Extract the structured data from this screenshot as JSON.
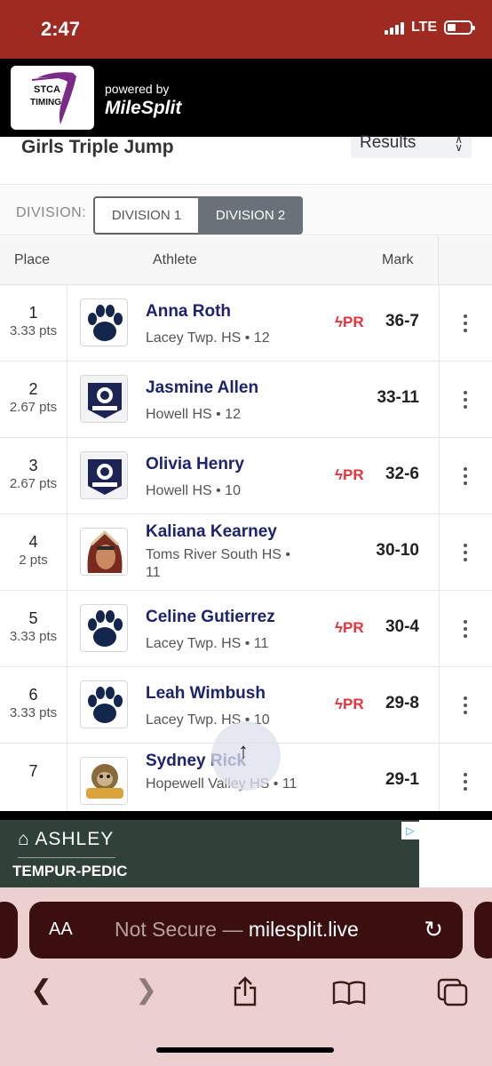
{
  "status": {
    "time": "2:47",
    "network": "LTE"
  },
  "brand": {
    "logo_line1": "STCA",
    "logo_line2": "TIMING",
    "powered_by": "powered by",
    "milesplit": "MileSplit"
  },
  "event": {
    "title": "Girls Triple Jump",
    "view_select": "Results"
  },
  "division": {
    "label": "DIVISION:",
    "options": [
      "DIVISION 1",
      "DIVISION 2"
    ],
    "selected": "DIVISION 2"
  },
  "table": {
    "headers": {
      "place": "Place",
      "athlete": "Athlete",
      "mark": "Mark"
    },
    "rows": [
      {
        "place": "1",
        "points": "3.33 pts",
        "name": "Anna Roth",
        "school": "Lacey Twp. HS • 12",
        "pr": "PR",
        "mark": "36-7",
        "logo": "paw-logo"
      },
      {
        "place": "2",
        "points": "2.67 pts",
        "name": "Jasmine Allen",
        "school": "Howell HS • 12",
        "pr": "",
        "mark": "33-11",
        "logo": "howell-logo"
      },
      {
        "place": "3",
        "points": "2.67 pts",
        "name": "Olivia Henry",
        "school": "Howell HS • 10",
        "pr": "PR",
        "mark": "32-6",
        "logo": "howell-logo"
      },
      {
        "place": "4",
        "points": "2 pts",
        "name": "Kaliana Kearney",
        "school": "Toms River South HS • 11",
        "pr": "",
        "mark": "30-10",
        "logo": "indian-logo"
      },
      {
        "place": "5",
        "points": "3.33 pts",
        "name": "Celine Gutierrez",
        "school": "Lacey Twp. HS • 11",
        "pr": "PR",
        "mark": "30-4",
        "logo": "paw-logo"
      },
      {
        "place": "6",
        "points": "3.33 pts",
        "name": "Leah Wimbush",
        "school": "Lacey Twp. HS • 10",
        "pr": "PR",
        "mark": "29-8",
        "logo": "paw-logo"
      },
      {
        "place": "7",
        "points": "",
        "name": "Sydney Rick",
        "school": "Hopewell Valley HS • 11",
        "pr": "",
        "mark": "29-1",
        "logo": "bulldogs-logo"
      }
    ]
  },
  "ad": {
    "brand1": "ASHLEY",
    "brand2": "TEMPUR-PEDIC"
  },
  "browser": {
    "aa": "AA",
    "url_prefix": "Not Secure — ",
    "url": "milesplit.live"
  },
  "colors": {
    "status_bar": "#9e2a22",
    "accent_navy": "#1c2470",
    "pr_red": "#e8333a",
    "browser_bg": "#eccfcf",
    "address_bg": "#3b0f0f"
  }
}
